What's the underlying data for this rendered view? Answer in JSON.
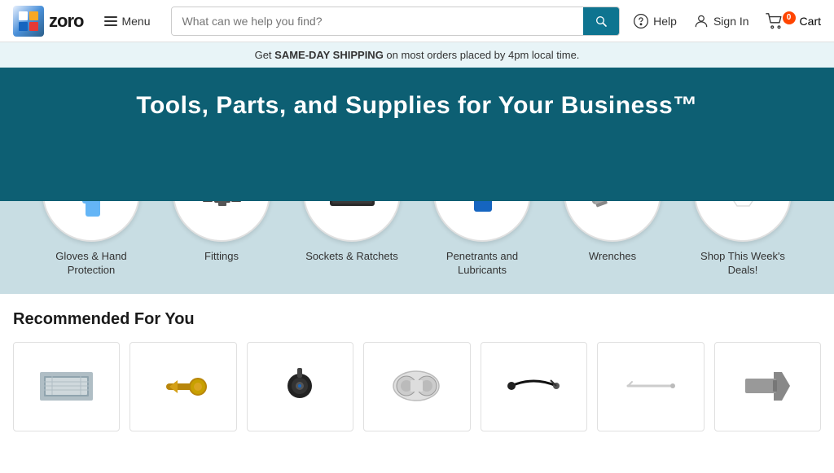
{
  "header": {
    "logo_text": "zoro",
    "menu_label": "Menu",
    "search_placeholder": "What can we help you find?",
    "help_label": "Help",
    "signin_label": "Sign In",
    "cart_label": "Cart",
    "cart_count": "0"
  },
  "shipping_banner": {
    "prefix": "Get ",
    "highlight": "SAME-DAY SHIPPING",
    "suffix": " on most orders placed by 4pm local time."
  },
  "hero": {
    "headline": "Tools, Parts, and Supplies for Your Business™"
  },
  "categories": [
    {
      "label": "Gloves & Hand Protection",
      "icon": "glove"
    },
    {
      "label": "Fittings",
      "icon": "fitting"
    },
    {
      "label": "Sockets & Ratchets",
      "icon": "socket"
    },
    {
      "label": "Penetrants and Lubricants",
      "icon": "penetrant"
    },
    {
      "label": "Wrenches",
      "icon": "wrench"
    },
    {
      "label": "Shop This Week's Deals!",
      "icon": "deals"
    }
  ],
  "recommended": {
    "title": "Recommended For You",
    "products": [
      {
        "id": 1,
        "type": "radiator"
      },
      {
        "id": 2,
        "type": "fitting-brass"
      },
      {
        "id": 3,
        "type": "sensor-black"
      },
      {
        "id": 4,
        "type": "fan-assembly"
      },
      {
        "id": 5,
        "type": "sensor-cable"
      },
      {
        "id": 6,
        "type": "wire"
      },
      {
        "id": 7,
        "type": "part"
      }
    ]
  }
}
